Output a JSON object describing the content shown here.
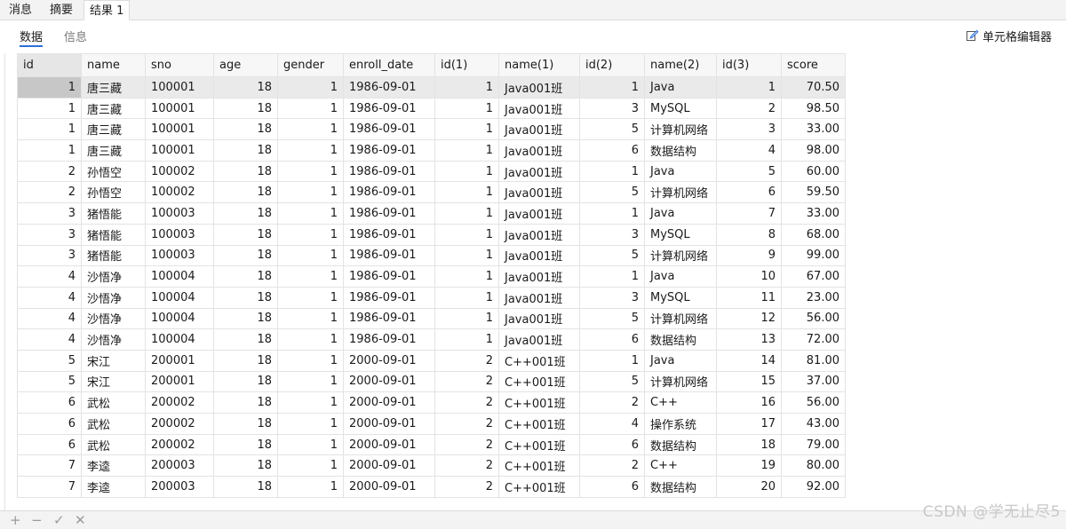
{
  "top_tabs": [
    "消息",
    "摘要",
    "结果 1"
  ],
  "sub_tabs": [
    "数据",
    "信息"
  ],
  "cell_editor_label": "单元格编辑器",
  "columns": [
    "id",
    "name",
    "sno",
    "age",
    "gender",
    "enroll_date",
    "id(1)",
    "name(1)",
    "id(2)",
    "name(2)",
    "id(3)",
    "score"
  ],
  "rows": [
    [
      "1",
      "唐三藏",
      "100001",
      "18",
      "1",
      "1986-09-01",
      "1",
      "Java001班",
      "1",
      "Java",
      "1",
      "70.50"
    ],
    [
      "1",
      "唐三藏",
      "100001",
      "18",
      "1",
      "1986-09-01",
      "1",
      "Java001班",
      "3",
      "MySQL",
      "2",
      "98.50"
    ],
    [
      "1",
      "唐三藏",
      "100001",
      "18",
      "1",
      "1986-09-01",
      "1",
      "Java001班",
      "5",
      "计算机网络",
      "3",
      "33.00"
    ],
    [
      "1",
      "唐三藏",
      "100001",
      "18",
      "1",
      "1986-09-01",
      "1",
      "Java001班",
      "6",
      "数据结构",
      "4",
      "98.00"
    ],
    [
      "2",
      "孙悟空",
      "100002",
      "18",
      "1",
      "1986-09-01",
      "1",
      "Java001班",
      "1",
      "Java",
      "5",
      "60.00"
    ],
    [
      "2",
      "孙悟空",
      "100002",
      "18",
      "1",
      "1986-09-01",
      "1",
      "Java001班",
      "5",
      "计算机网络",
      "6",
      "59.50"
    ],
    [
      "3",
      "猪悟能",
      "100003",
      "18",
      "1",
      "1986-09-01",
      "1",
      "Java001班",
      "1",
      "Java",
      "7",
      "33.00"
    ],
    [
      "3",
      "猪悟能",
      "100003",
      "18",
      "1",
      "1986-09-01",
      "1",
      "Java001班",
      "3",
      "MySQL",
      "8",
      "68.00"
    ],
    [
      "3",
      "猪悟能",
      "100003",
      "18",
      "1",
      "1986-09-01",
      "1",
      "Java001班",
      "5",
      "计算机网络",
      "9",
      "99.00"
    ],
    [
      "4",
      "沙悟净",
      "100004",
      "18",
      "1",
      "1986-09-01",
      "1",
      "Java001班",
      "1",
      "Java",
      "10",
      "67.00"
    ],
    [
      "4",
      "沙悟净",
      "100004",
      "18",
      "1",
      "1986-09-01",
      "1",
      "Java001班",
      "3",
      "MySQL",
      "11",
      "23.00"
    ],
    [
      "4",
      "沙悟净",
      "100004",
      "18",
      "1",
      "1986-09-01",
      "1",
      "Java001班",
      "5",
      "计算机网络",
      "12",
      "56.00"
    ],
    [
      "4",
      "沙悟净",
      "100004",
      "18",
      "1",
      "1986-09-01",
      "1",
      "Java001班",
      "6",
      "数据结构",
      "13",
      "72.00"
    ],
    [
      "5",
      "宋江",
      "200001",
      "18",
      "1",
      "2000-09-01",
      "2",
      "C++001班",
      "1",
      "Java",
      "14",
      "81.00"
    ],
    [
      "5",
      "宋江",
      "200001",
      "18",
      "1",
      "2000-09-01",
      "2",
      "C++001班",
      "5",
      "计算机网络",
      "15",
      "37.00"
    ],
    [
      "6",
      "武松",
      "200002",
      "18",
      "1",
      "2000-09-01",
      "2",
      "C++001班",
      "2",
      "C++",
      "16",
      "56.00"
    ],
    [
      "6",
      "武松",
      "200002",
      "18",
      "1",
      "2000-09-01",
      "2",
      "C++001班",
      "4",
      "操作系统",
      "17",
      "43.00"
    ],
    [
      "6",
      "武松",
      "200002",
      "18",
      "1",
      "2000-09-01",
      "2",
      "C++001班",
      "6",
      "数据结构",
      "18",
      "79.00"
    ],
    [
      "7",
      "李逵",
      "200003",
      "18",
      "1",
      "2000-09-01",
      "2",
      "C++001班",
      "2",
      "C++",
      "19",
      "80.00"
    ],
    [
      "7",
      "李逵",
      "200003",
      "18",
      "1",
      "2000-09-01",
      "2",
      "C++001班",
      "6",
      "数据结构",
      "20",
      "92.00"
    ]
  ],
  "column_align": [
    "num",
    "txt",
    "txt",
    "num",
    "num",
    "txt",
    "num",
    "txt",
    "num",
    "txt",
    "num",
    "num"
  ],
  "selected_row": 0,
  "bottom_toolbar": {
    "add": "+",
    "remove": "−",
    "apply": "✓",
    "discard": "✕"
  },
  "watermark": "CSDN @学无止尽5"
}
